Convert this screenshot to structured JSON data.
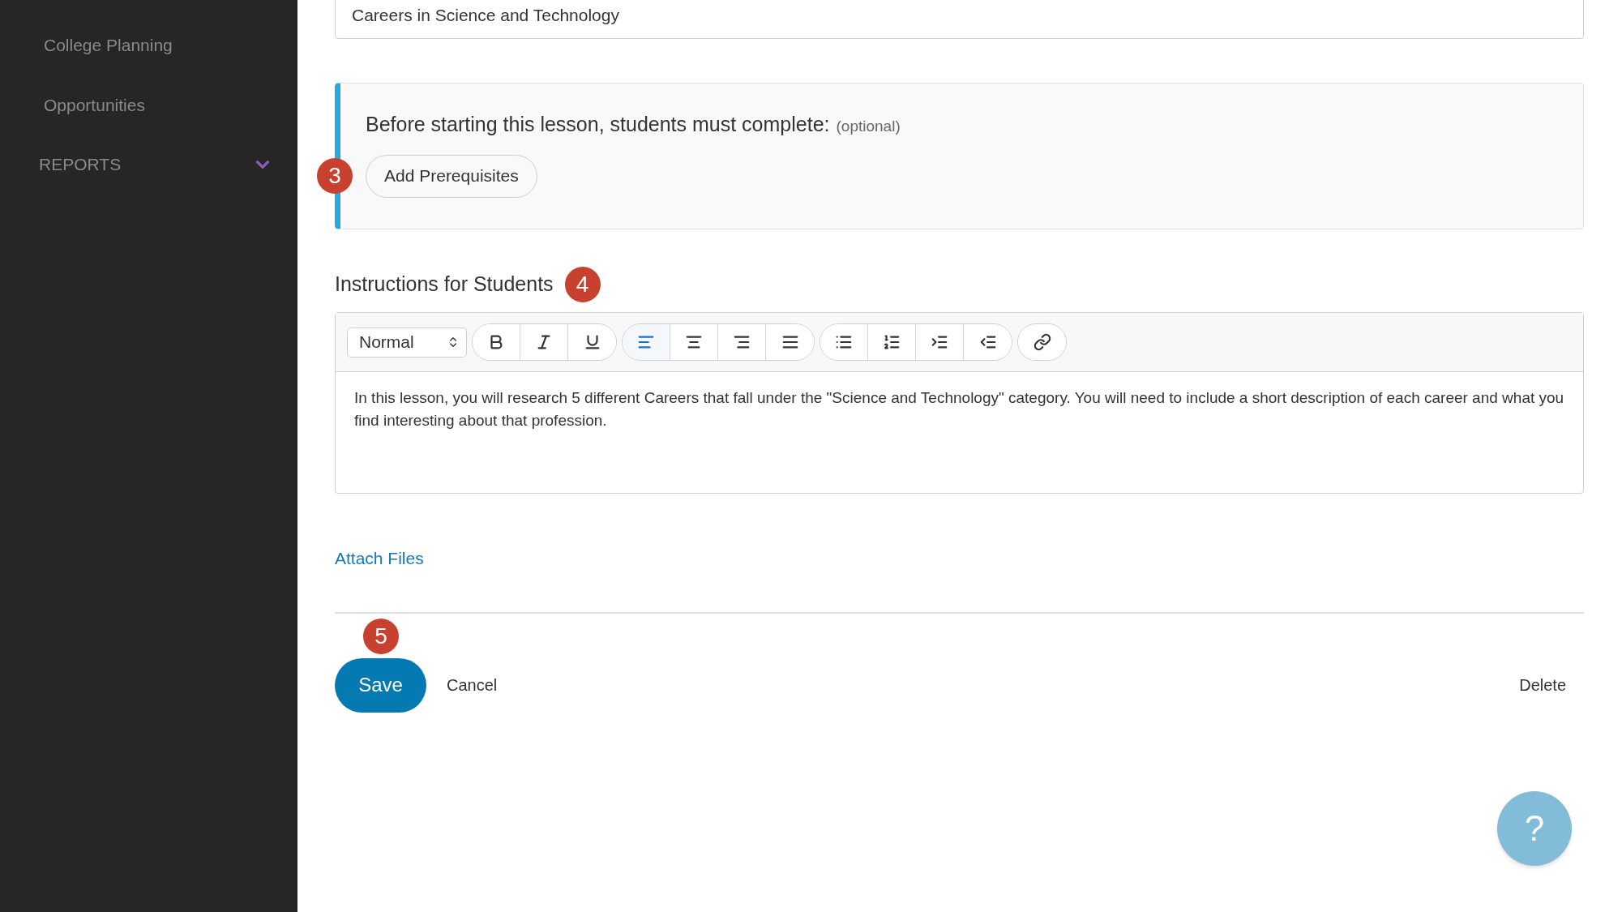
{
  "sidebar": {
    "items": [
      {
        "label": "College Planning"
      },
      {
        "label": "Opportunities"
      }
    ],
    "section": {
      "label": "REPORTS"
    }
  },
  "title_field": {
    "value": "Careers in Science and Technology"
  },
  "prerequisites": {
    "badge": "3",
    "heading": "Before starting this lesson, students must complete:",
    "note": "(optional)",
    "button": "Add Prerequisites"
  },
  "instructions": {
    "heading": "Instructions for Students",
    "badge": "4",
    "toolbar": {
      "format": "Normal",
      "groups": [
        {
          "buttons": [
            {
              "selected": false
            },
            {
              "selected": false
            },
            {
              "selected": false
            }
          ]
        },
        {
          "buttons": [
            {
              "selected": true
            },
            {
              "selected": false
            },
            {
              "selected": false
            },
            {
              "selected": false
            }
          ]
        },
        {
          "buttons": [
            {
              "selected": false
            },
            {
              "selected": false
            },
            {
              "selected": false
            },
            {
              "selected": false
            }
          ]
        },
        {
          "buttons": [
            {
              "selected": false
            }
          ]
        }
      ]
    },
    "text": "In this lesson, you will research 5 different Careers that fall under the \"Science and Technology\" category. You will need to include a short description of each career and what you find interesting about that profession."
  },
  "attach_link": "Attach Files",
  "actions": {
    "badge": "5",
    "save": "Save",
    "cancel": "Cancel",
    "delete": "Delete"
  },
  "help_button": "?"
}
